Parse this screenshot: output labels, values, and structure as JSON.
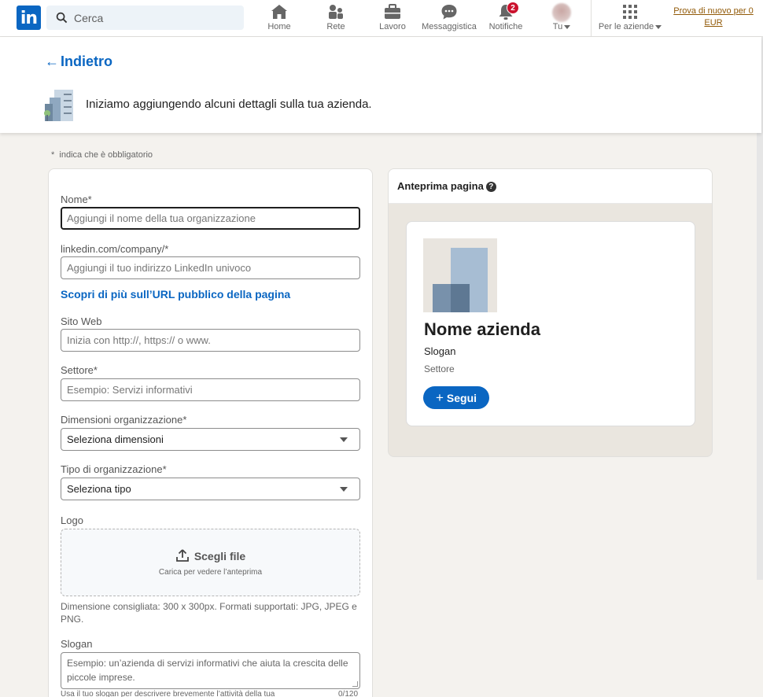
{
  "nav": {
    "logo_text": "in",
    "search_placeholder": "Cerca",
    "items": [
      {
        "label": "Home",
        "icon": "home-icon"
      },
      {
        "label": "Rete",
        "icon": "network-icon"
      },
      {
        "label": "Lavoro",
        "icon": "briefcase-icon"
      },
      {
        "label": "Messaggistica",
        "icon": "messaging-icon"
      },
      {
        "label": "Notifiche",
        "icon": "bell-icon",
        "badge": "2"
      },
      {
        "label": "Tu",
        "icon": "avatar"
      },
      {
        "label": "Per le aziende",
        "icon": "grid-icon"
      }
    ],
    "premium": "Prova di nuovo per 0 EUR"
  },
  "header": {
    "back_label": "Indietro",
    "intro": "Iniziamo aggiungendo alcuni dettagli sulla tua azienda."
  },
  "form": {
    "required_note": "indica che è obbligatorio",
    "name_label": "Nome*",
    "name_placeholder": "Aggiungi il nome della tua organizzazione",
    "url_label": "linkedin.com/company/*",
    "url_placeholder": "Aggiungi il tuo indirizzo LinkedIn univoco",
    "url_link": "Scopri di più sull’URL pubblico della pagina",
    "website_label": "Sito Web",
    "website_placeholder": "Inizia con http://, https:// o www.",
    "industry_label": "Settore*",
    "industry_placeholder": "Esempio: Servizi informativi",
    "size_label": "Dimensioni organizzazione*",
    "size_value": "Seleziona dimensioni",
    "type_label": "Tipo di organizzazione*",
    "type_value": "Seleziona tipo",
    "logo_label": "Logo",
    "logo_button": "Scegli file",
    "logo_sub": "Carica per vedere l’anteprima",
    "logo_hint": "Dimensione consigliata: 300 x 300px. Formati supportati: JPG, JPEG e PNG.",
    "slogan_label": "Slogan",
    "slogan_placeholder": "Esempio: un’azienda di servizi informativi che aiuta la crescita delle piccole imprese.",
    "slogan_hint": "Usa il tuo slogan per descrivere brevemente l’attività della tua",
    "slogan_counter": "0/120"
  },
  "preview": {
    "title": "Anteprima pagina",
    "company_name": "Nome azienda",
    "slogan": "Slogan",
    "sector": "Settore",
    "follow_label": "Segui"
  },
  "colors": {
    "brand": "#0a66c2",
    "badge": "#cb112d",
    "premium": "#915907",
    "background": "#f4f2ee"
  }
}
